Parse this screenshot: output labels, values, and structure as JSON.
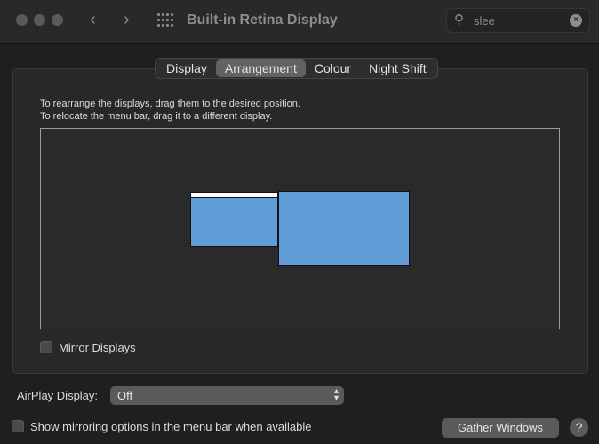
{
  "window": {
    "title": "Built-in Retina Display",
    "back_icon": "‹",
    "forward_icon": "›"
  },
  "search": {
    "value": "slee",
    "icon": "search-icon",
    "clear_icon": "clear-icon"
  },
  "tabs": [
    {
      "label": "Display"
    },
    {
      "label": "Arrangement",
      "selected": true
    },
    {
      "label": "Colour"
    },
    {
      "label": "Night Shift"
    }
  ],
  "arrangement": {
    "instruction1": "To rearrange the displays, drag them to the desired position.",
    "instruction2": "To relocate the menu bar, drag it to a different display.",
    "display_color": "#609cd6"
  },
  "mirror_displays": {
    "label": "Mirror Displays",
    "checked": false
  },
  "airplay": {
    "label": "AirPlay Display:",
    "value": "Off"
  },
  "show_mirroring": {
    "label": "Show mirroring options in the menu bar when available",
    "checked": false
  },
  "gather_windows": "Gather Windows",
  "help": "?"
}
